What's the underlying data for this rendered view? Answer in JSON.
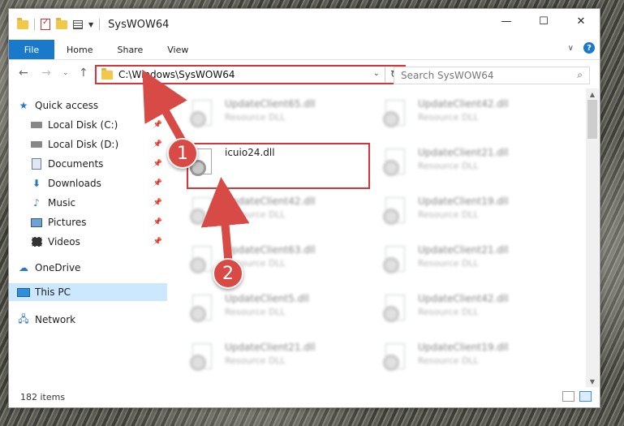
{
  "window": {
    "title": "SysWOW64",
    "controls": {
      "minimize": "—",
      "maximize": "☐",
      "close": "✕"
    }
  },
  "ribbon": {
    "tabs": [
      {
        "label": "File"
      },
      {
        "label": "Home"
      },
      {
        "label": "Share"
      },
      {
        "label": "View"
      }
    ]
  },
  "address_bar": {
    "path": "C:\\Windows\\SysWOW64",
    "search_placeholder": "Search SysWOW64"
  },
  "nav_pane": {
    "items": [
      {
        "label": "Quick access",
        "icon": "star-icon"
      },
      {
        "label": "Local Disk (C:)",
        "icon": "drive-icon",
        "pinned": true
      },
      {
        "label": "Local Disk (D:)",
        "icon": "drive-icon",
        "pinned": true
      },
      {
        "label": "Documents",
        "icon": "documents-icon",
        "pinned": true
      },
      {
        "label": "Downloads",
        "icon": "download-icon",
        "pinned": true
      },
      {
        "label": "Music",
        "icon": "music-icon",
        "pinned": true
      },
      {
        "label": "Pictures",
        "icon": "pictures-icon",
        "pinned": true
      },
      {
        "label": "Videos",
        "icon": "videos-icon",
        "pinned": true
      },
      {
        "label": "OneDrive",
        "icon": "cloud-icon"
      },
      {
        "label": "This PC",
        "icon": "computer-icon",
        "selected": true
      },
      {
        "label": "Network",
        "icon": "network-icon"
      }
    ]
  },
  "files": {
    "left_column": [
      {
        "name": "UpdateClient65.dll",
        "type": "Resource DLL"
      },
      {
        "name": "icuio24.dll",
        "type": ""
      },
      {
        "name": "UpdateClient42.dll",
        "type": "Resource DLL"
      },
      {
        "name": "UpdateClient63.dll",
        "type": "Resource DLL"
      },
      {
        "name": "UpdateClient5.dll",
        "type": "Resource DLL"
      },
      {
        "name": "UpdateClient21.dll",
        "type": "Resource DLL"
      }
    ],
    "right_column": [
      {
        "name": "UpdateClient42.dll",
        "type": "Resource DLL"
      },
      {
        "name": "UpdateClient21.dll",
        "type": "Resource DLL"
      },
      {
        "name": "UpdateClient19.dll",
        "type": "Resource DLL"
      },
      {
        "name": "UpdateClient21.dll",
        "type": "Resource DLL"
      },
      {
        "name": "UpdateClient42.dll",
        "type": "Resource DLL"
      },
      {
        "name": "UpdateClient19.dll",
        "type": "Resource DLL"
      }
    ]
  },
  "status_bar": {
    "item_count": "182 items"
  },
  "annotations": {
    "step1": "1",
    "step2": "2",
    "highlight_color": "#d6363b",
    "badge_color": "#d84a45"
  }
}
